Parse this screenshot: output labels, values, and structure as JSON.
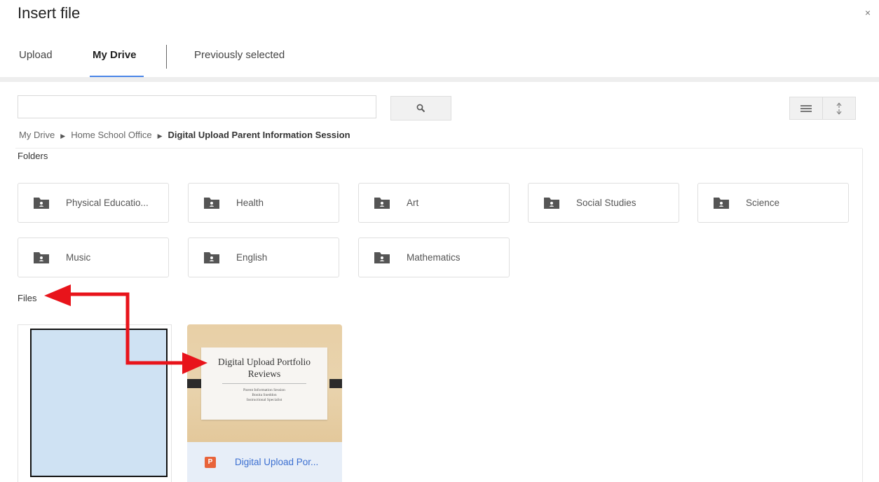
{
  "dialog": {
    "title": "Insert file",
    "close_glyph": "×"
  },
  "tabs": [
    {
      "label": "Upload",
      "active": false
    },
    {
      "label": "My Drive",
      "active": true
    },
    {
      "label": "Previously selected",
      "active": false
    }
  ],
  "search": {
    "value": "",
    "placeholder": "",
    "button_icon": "search-icon"
  },
  "view_toggle": [
    {
      "icon": "list-view-icon"
    },
    {
      "icon": "sort-icon"
    }
  ],
  "breadcrumb": [
    "My Drive",
    "Home School Office",
    "Digital Upload Parent Information Session"
  ],
  "folders_label": "Folders",
  "folders": [
    {
      "name": "Physical Educatio..."
    },
    {
      "name": "Health"
    },
    {
      "name": "Art"
    },
    {
      "name": "Social Studies"
    },
    {
      "name": "Science"
    },
    {
      "name": "Music"
    },
    {
      "name": "English"
    },
    {
      "name": "Mathematics"
    }
  ],
  "files_label": "Files",
  "files": [
    {
      "name": "",
      "thumb_color": "#cfe2f3"
    },
    {
      "name": "Digital Upload Por...",
      "type": "presentation",
      "type_badge": "P",
      "slide_title": "Digital Upload Portfolio Reviews",
      "slide_lines": [
        "Parent Information Session",
        "Bonita Sneddon",
        "Instructional Specialist"
      ]
    }
  ],
  "colors": {
    "accent": "#4a86e8",
    "annotation_arrow": "#e8141b",
    "folder_icon": "#555555",
    "presentation_icon": "#e8633a"
  }
}
